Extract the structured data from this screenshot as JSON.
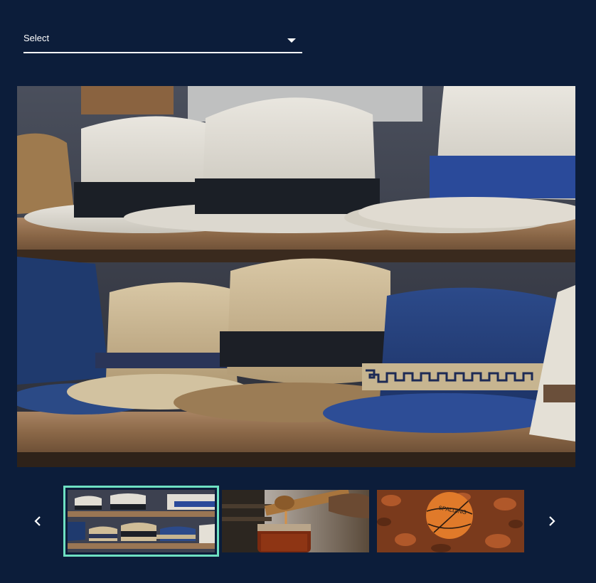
{
  "select": {
    "label": "Select",
    "icon": "caret-down-icon"
  },
  "main_image": {
    "subject": "hats-on-shelves"
  },
  "carousel": {
    "prev_icon": "chevron-left-icon",
    "next_icon": "chevron-right-icon",
    "active_index": 0,
    "thumbnails": [
      {
        "subject": "hats-on-shelves"
      },
      {
        "subject": "honey-jar-with-dipper"
      },
      {
        "subject": "basketball-on-leaves",
        "brand_text": "SPALDING"
      }
    ]
  },
  "colors": {
    "background": "#0c1d3a",
    "active_border": "#6ee0c2",
    "text": "#ffffff"
  }
}
